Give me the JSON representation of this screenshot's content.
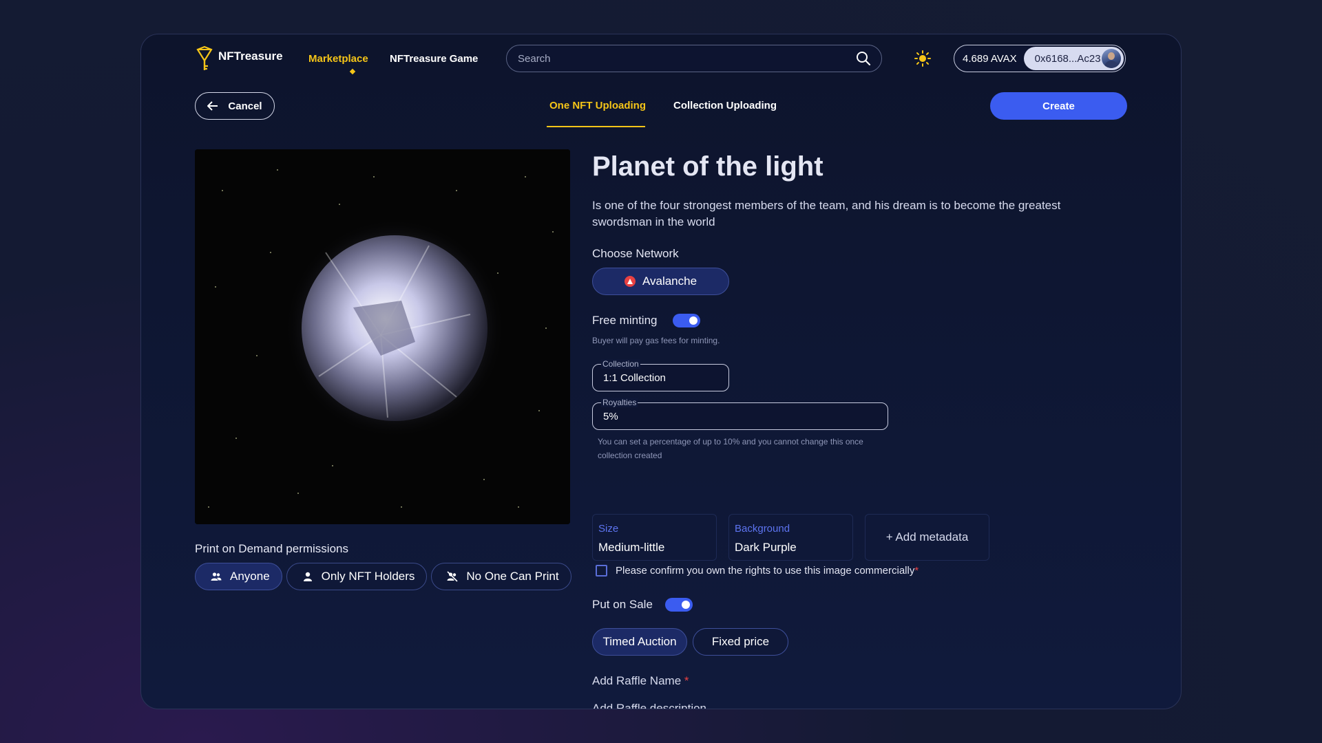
{
  "header": {
    "logo_text": "NFTreasure",
    "nav": [
      {
        "label": "Marketplace",
        "active": true
      },
      {
        "label": "NFTreasure Game",
        "active": false
      }
    ],
    "search_placeholder": "Search",
    "wallet": {
      "balance": "4.689 AVAX",
      "address": "0x6168...Ac23"
    }
  },
  "toolbar": {
    "cancel_label": "Cancel",
    "tabs": [
      {
        "label": "One NFT Uploading",
        "active": true
      },
      {
        "label": "Collection Uploading",
        "active": false
      }
    ],
    "create_label": "Create"
  },
  "nft": {
    "title": "Planet of the light",
    "description": "Is one of the four strongest members of the team, and his dream is to become the greatest swordsman in the world"
  },
  "network": {
    "label": "Choose Network",
    "selected": "Avalanche"
  },
  "free_minting": {
    "label": "Free minting",
    "enabled": true,
    "hint": "Buyer will pay gas fees for minting."
  },
  "collection": {
    "label": "Collection",
    "value": "1:1 Collection"
  },
  "royalties": {
    "label": "Royalties",
    "value": "5%",
    "hint": "You can set a percentage of up to 10% and you cannot change this once collection created"
  },
  "metadata": [
    {
      "key": "Size",
      "value": "Medium-little"
    },
    {
      "key": "Background",
      "value": "Dark Purple"
    }
  ],
  "add_metadata_label": "+ Add metadata",
  "rights": {
    "label": "Please confirm you own the rights to use this image commercially",
    "required_mark": "*",
    "checked": false
  },
  "put_on_sale": {
    "label": "Put on Sale",
    "enabled": true
  },
  "sale_types": [
    {
      "label": "Timed Auction",
      "active": true
    },
    {
      "label": "Fixed price",
      "active": false
    }
  ],
  "raffle": {
    "name_label": "Add Raffle Name",
    "name_required_mark": "*",
    "description_label": "Add Raffle description"
  },
  "print_on_demand": {
    "label": "Print on Demand permissions",
    "options": [
      {
        "label": "Anyone",
        "icon": "users-icon",
        "active": true
      },
      {
        "label": "Only NFT Holders",
        "icon": "user-icon",
        "active": false
      },
      {
        "label": "No One Can Print",
        "icon": "users-off-icon",
        "active": false
      }
    ]
  },
  "colors": {
    "accent": "#3b5cf0",
    "highlight": "#f5c518",
    "required": "#e84142"
  }
}
